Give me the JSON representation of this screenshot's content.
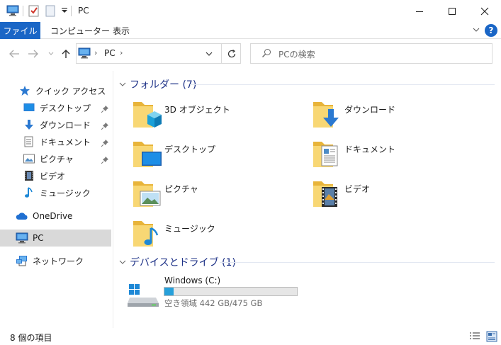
{
  "window": {
    "title": "PC",
    "controls": {
      "minimize": "─",
      "maximize": "☐",
      "close": "✕"
    }
  },
  "ribbon": {
    "tabs": [
      {
        "label": "ファイル",
        "active": true
      },
      {
        "label": "コンピューター"
      },
      {
        "label": "表示"
      }
    ],
    "help": "?"
  },
  "address": {
    "path": [
      "PC"
    ],
    "search_placeholder": "PCの検索"
  },
  "nav": {
    "quick_access": "クイック アクセス",
    "items": [
      {
        "label": "デスクトップ",
        "icon": "desktop-icon",
        "pinned": true
      },
      {
        "label": "ダウンロード",
        "icon": "download-icon",
        "pinned": true
      },
      {
        "label": "ドキュメント",
        "icon": "document-icon",
        "pinned": true
      },
      {
        "label": "ピクチャ",
        "icon": "picture-icon",
        "pinned": true
      },
      {
        "label": "ビデオ",
        "icon": "video-icon",
        "pinned": false
      },
      {
        "label": "ミュージック",
        "icon": "music-icon",
        "pinned": false
      }
    ],
    "onedrive": "OneDrive",
    "pc": "PC",
    "network": "ネットワーク"
  },
  "content": {
    "folders_header": "フォルダー (7)",
    "folders": [
      {
        "label": "3D オブジェクト",
        "icon": "3d-objects-icon"
      },
      {
        "label": "ダウンロード",
        "icon": "download-icon"
      },
      {
        "label": "デスクトップ",
        "icon": "desktop-icon"
      },
      {
        "label": "ドキュメント",
        "icon": "document-icon"
      },
      {
        "label": "ピクチャ",
        "icon": "picture-icon"
      },
      {
        "label": "ビデオ",
        "icon": "video-icon"
      },
      {
        "label": "ミュージック",
        "icon": "music-icon"
      }
    ],
    "drives_header": "デバイスとドライブ (1)",
    "drive": {
      "name": "Windows (C:)",
      "space_text": "空き領域 442 GB/475 GB",
      "used_fraction": 0.07
    }
  },
  "status": {
    "item_count": "8 個の項目"
  },
  "colors": {
    "accent": "#1a66c6",
    "section_header": "#1e3287",
    "drive_fill": "#26a0da",
    "selected_bg": "#d9d9d9"
  }
}
